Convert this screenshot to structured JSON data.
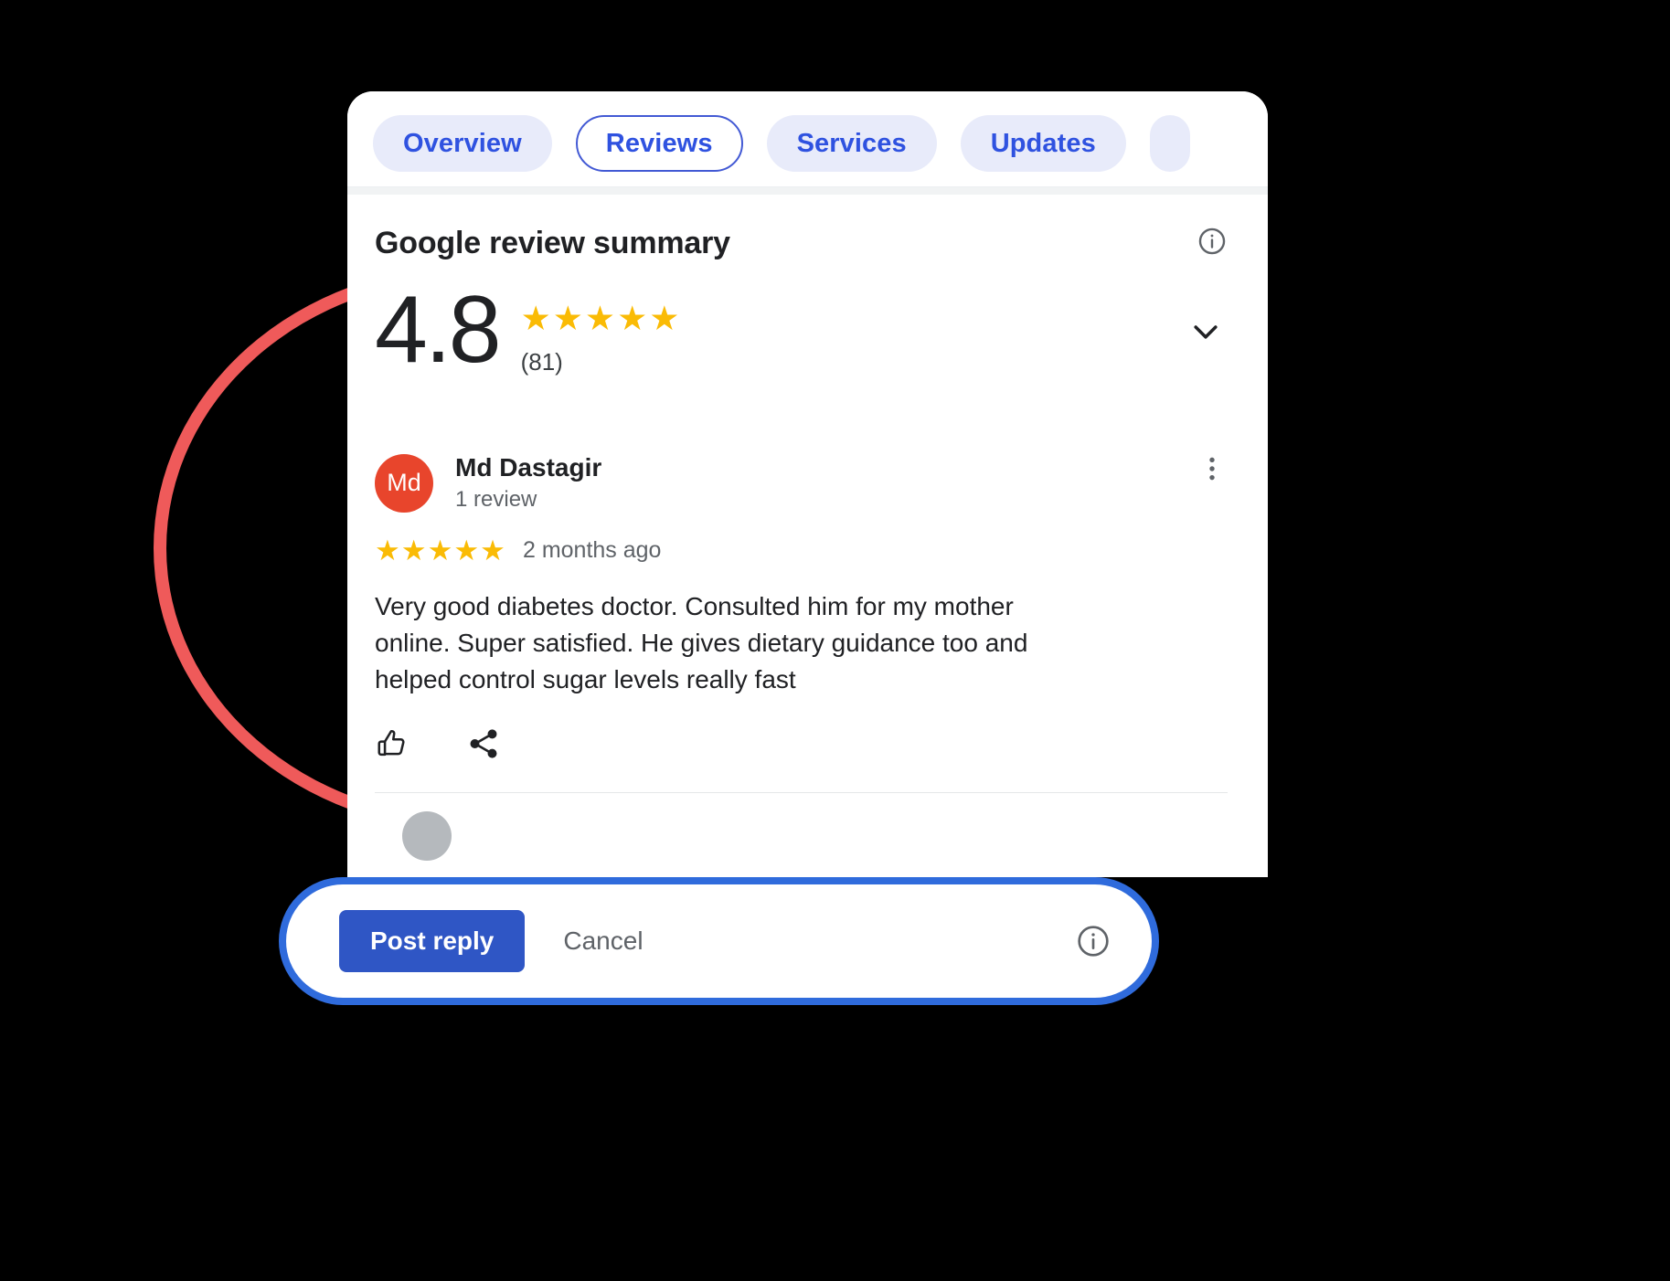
{
  "tabs": [
    {
      "label": "Overview",
      "selected": false
    },
    {
      "label": "Reviews",
      "selected": true
    },
    {
      "label": "Services",
      "selected": false
    },
    {
      "label": "Updates",
      "selected": false
    }
  ],
  "summary": {
    "title": "Google review summary",
    "rating": "4.8",
    "stars": "★★★★★",
    "count": "(81)",
    "info_icon": "info-circle-icon",
    "expand_icon": "chevron-down-icon"
  },
  "review": {
    "avatar_initials": "Md",
    "avatar_color": "#e8452c",
    "name": "Md Dastagir",
    "review_count": "1 review",
    "stars": "★★★★★",
    "date": "2 months ago",
    "text": "Very good diabetes doctor. Consulted him for my mother online. Super satisfied. He gives dietary guidance too and helped control sugar levels really fast",
    "more_icon": "more-vert-icon",
    "like_icon": "thumb-up-icon",
    "share_icon": "share-icon"
  },
  "reply_bar": {
    "post_label": "Post reply",
    "cancel_label": "Cancel",
    "info_icon": "info-circle-icon",
    "accent_color": "#2f6bdc",
    "button_color": "#2f56c5"
  },
  "annotation": {
    "shape": "circle-highlight",
    "color": "#ef5a5a"
  }
}
